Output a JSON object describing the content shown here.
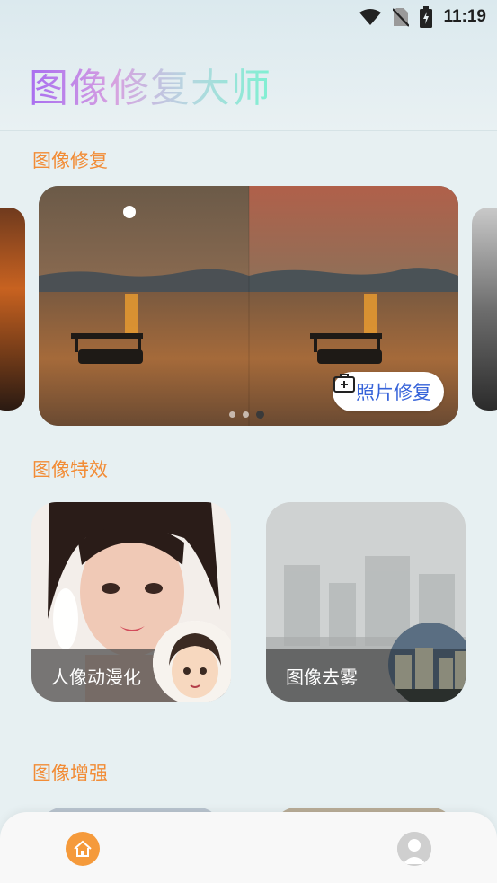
{
  "status_bar": {
    "time": "11:19",
    "icons": [
      "wifi-icon",
      "no-sim-icon",
      "battery-charging-icon"
    ]
  },
  "header": {
    "app_title": "图像修复大师"
  },
  "sections": {
    "repair": {
      "title": "图像修复"
    },
    "effects": {
      "title": "图像特效"
    },
    "enhance": {
      "title": "图像增强"
    }
  },
  "carousel": {
    "button_label": "照片修复",
    "button_icon": "medical-kit-icon",
    "page_count": 3,
    "active_index": 2
  },
  "feature_cards": [
    {
      "label": "人像动漫化",
      "icon": "anime-avatar-thumb"
    },
    {
      "label": "图像去雾",
      "icon": "clear-city-thumb"
    }
  ],
  "tabbar": {
    "items": [
      {
        "icon": "home-icon",
        "active": true
      },
      {
        "icon": "user-avatar-icon",
        "active": false
      }
    ]
  },
  "colors": {
    "section_title": "#f28c36",
    "button_text": "#3562d9",
    "tab_active": "#f59a3b"
  }
}
